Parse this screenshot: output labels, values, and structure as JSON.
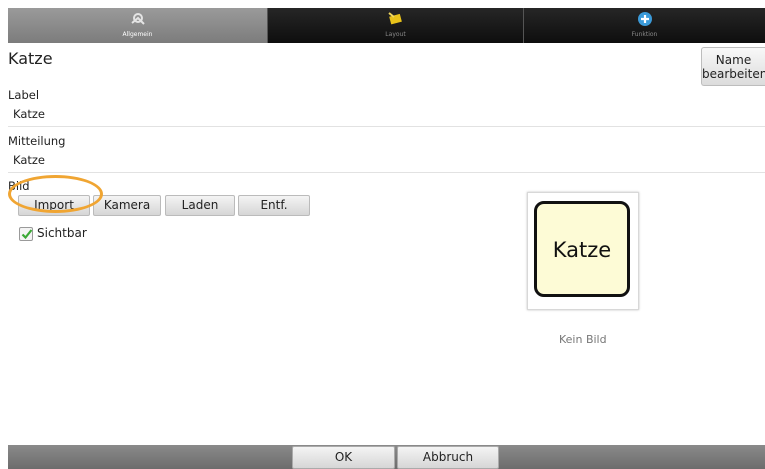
{
  "tabs": [
    {
      "label": "Allgemein",
      "icon": "settings-icon"
    },
    {
      "label": "Layout",
      "icon": "layout-icon"
    },
    {
      "label": "Funktion",
      "icon": "add-function-icon"
    }
  ],
  "header": {
    "title": "Katze",
    "rename_line1": "Name",
    "rename_line2": "bearbeiten"
  },
  "form": {
    "label_caption": "Label",
    "label_value": "Katze",
    "message_caption": "Mitteilung",
    "message_value": "Katze",
    "image_caption": "Bild",
    "image_buttons": [
      "Import",
      "Kamera",
      "Laden",
      "Entf."
    ],
    "visible_label": "Sichtbar",
    "visible_checked": true
  },
  "preview": {
    "symbol_text": "Katze",
    "no_image_text": "Kein Bild"
  },
  "footer": {
    "ok_label": "OK",
    "cancel_label": "Abbruch"
  },
  "colors": {
    "highlight_ring": "#f0a532",
    "checkmark": "#3aa935",
    "symbol_background": "#fdfbd6"
  }
}
